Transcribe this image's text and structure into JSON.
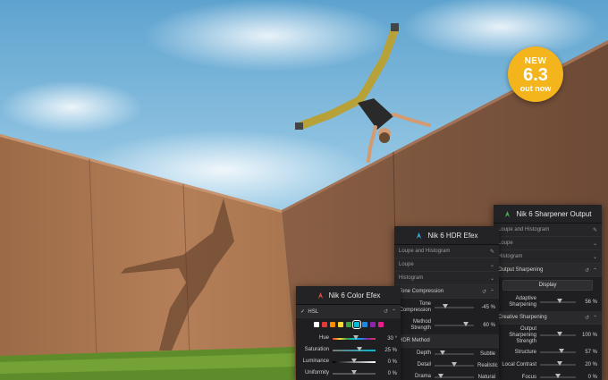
{
  "badge": {
    "line1": "NEW",
    "line2": "6.3",
    "line3": "out now"
  },
  "colors": {
    "badge": "#f3b41c",
    "panel": "#1f1f21",
    "sharpen_accent": "#d08a2a",
    "color_accent": "#3da9e0"
  },
  "color_panel": {
    "title": "Nik 6 Color Efex",
    "section": "HSL",
    "swatches": [
      "#ffffff",
      "#e53935",
      "#fb8c00",
      "#fdd835",
      "#43a047",
      "#00bcd4",
      "#1e88e5",
      "#8e24aa",
      "#e91e8c"
    ],
    "selected_swatch_index": 5,
    "sliders": [
      {
        "label": "Hue",
        "value": "30 °",
        "level": 0.55
      },
      {
        "label": "Saturation",
        "value": "25 %",
        "level": 0.62
      },
      {
        "label": "Luminance",
        "value": "0 %",
        "level": 0.5
      },
      {
        "label": "Uniformity",
        "value": "0 %",
        "level": 0.5
      }
    ]
  },
  "hdr_panel": {
    "title": "Nik 6 HDR Efex",
    "sections": [
      "Loupe and Histogram",
      "Loupe",
      "Histogram"
    ],
    "tone_section": "Tone Compression",
    "tone_sliders": [
      {
        "label": "Tone Compression",
        "value": "-45 %",
        "level": 0.28
      },
      {
        "label": "Method Strength",
        "value": "60 %",
        "level": 0.8
      }
    ],
    "method_section": "HDR Method",
    "method_sliders": [
      {
        "label": "Depth",
        "value": "Subtle",
        "level": 0.2
      },
      {
        "label": "Detail",
        "value": "Realistic",
        "level": 0.5
      },
      {
        "label": "Drama",
        "value": "Natural",
        "level": 0.15
      }
    ]
  },
  "sharpener_panel": {
    "title": "Nik 6 Sharpener Output",
    "sections": [
      "Loupe and Histogram",
      "Loupe",
      "Histogram"
    ],
    "output_section": "Output Sharpening",
    "display_option": "Display",
    "adaptive": {
      "label": "Adaptive Sharpening",
      "value": "56 %",
      "level": 0.56
    },
    "creative_section": "Creative Sharpening",
    "creative_sliders": [
      {
        "label": "Output Sharpening Strength",
        "value": "100 %",
        "level": 0.55
      },
      {
        "label": "Structure",
        "value": "57 %",
        "level": 0.6
      },
      {
        "label": "Local Contrast",
        "value": "20 %",
        "level": 0.55
      },
      {
        "label": "Focus",
        "value": "0 %",
        "level": 0.5
      }
    ]
  }
}
